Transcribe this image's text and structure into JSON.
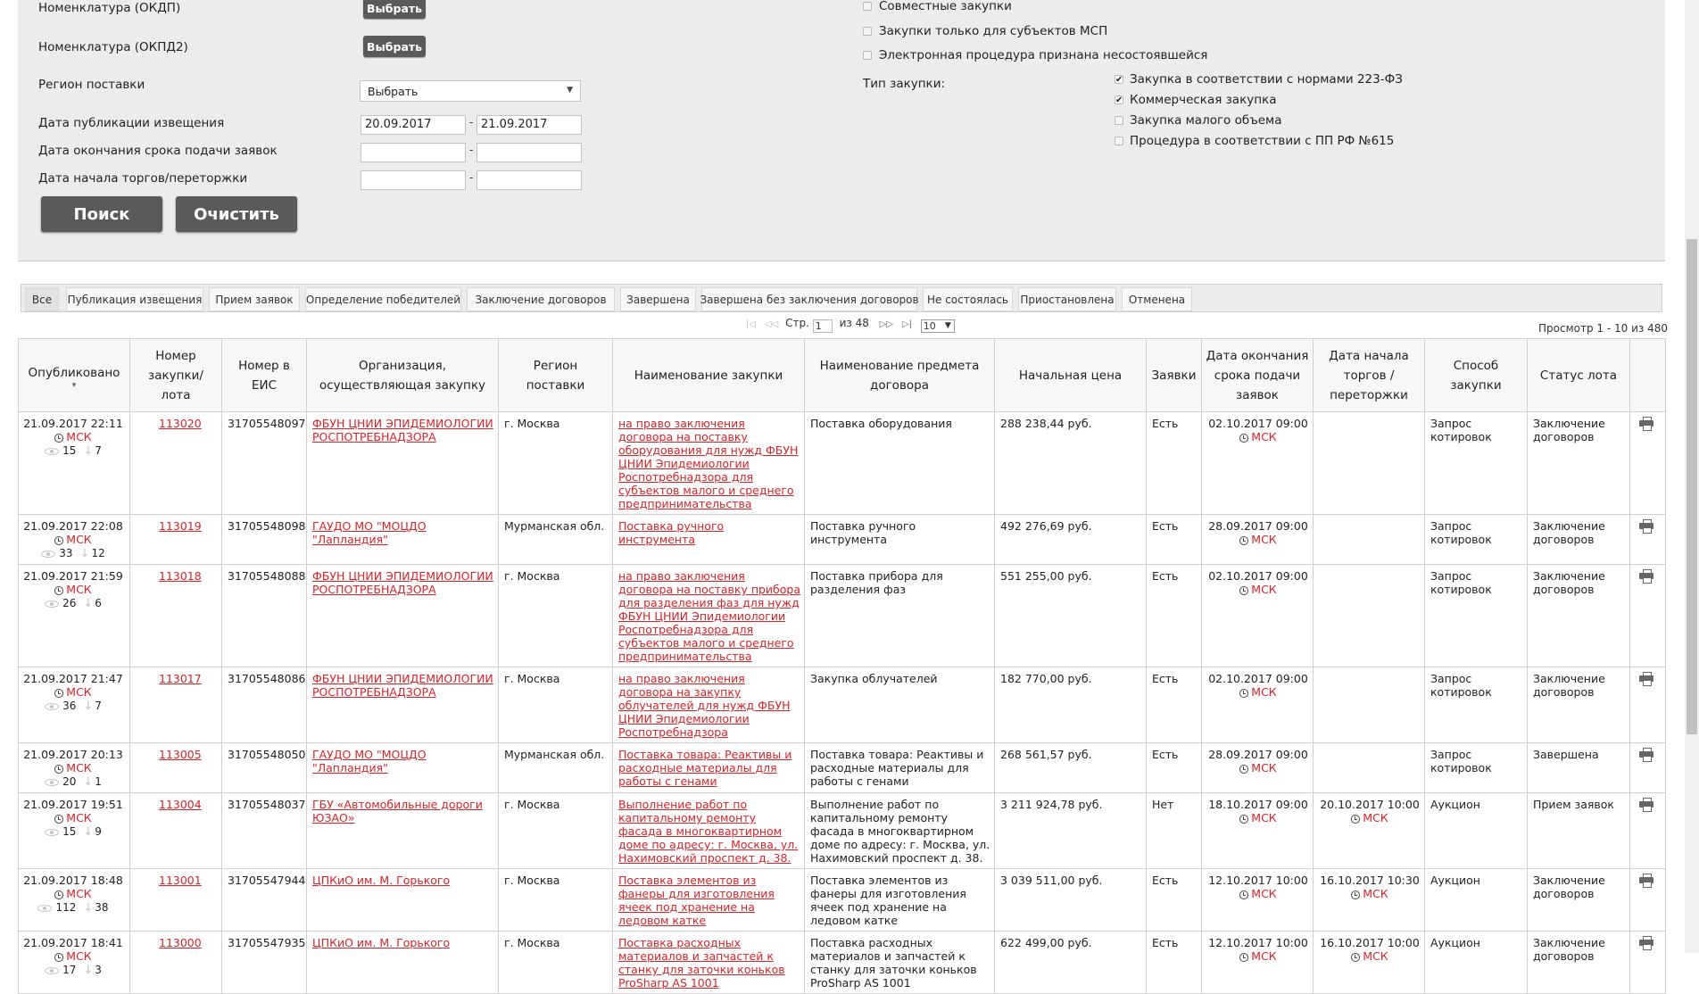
{
  "filters": {
    "okdp_label": "Номенклатура (ОКДП)",
    "okpd2_label": "Номенклатура (ОКПД2)",
    "choose_button": "Выбрать",
    "region_label": "Регион поставки",
    "region_value": "Выбрать",
    "pub_date_label": "Дата публикации извещения",
    "pub_date_from": "20.09.2017",
    "pub_date_to": "21.09.2017",
    "deadline_label": "Дата окончания срока подачи заявок",
    "auction_label": "Дата начала торгов/переторжки",
    "dash": "-",
    "search_button": "Поиск",
    "clear_button": "Очистить",
    "joint_label": "Совместные закупки",
    "msp_label": "Закупки только для субъектов МСП",
    "failed_label": "Электронная процедура признана несостоявшейся",
    "type_label": "Тип закупки:",
    "type_options": [
      {
        "label": "Закупка в соответствии с нормами 223-ФЗ",
        "checked": true,
        "mark": "✔"
      },
      {
        "label": "Коммерческая закупка",
        "checked": true,
        "mark": "✔"
      },
      {
        "label": "Закупка малого объема",
        "checked": false,
        "mark": ""
      },
      {
        "label": "Процедура в соответствии с ПП РФ №615",
        "checked": false,
        "mark": ""
      }
    ]
  },
  "tabs": [
    "Все",
    "Публикация извещения",
    "Прием заявок",
    "Определение победителей",
    "Заключение договоров",
    "Завершена",
    "Завершена без заключения договоров",
    "Не состоялась",
    "Приостановлена",
    "Отменена"
  ],
  "pager": {
    "first": "|◁",
    "prev": "◁◁",
    "page_label": "Стр.",
    "page": "1",
    "of_label": "из 48",
    "next": "▷▷",
    "last": "▷|",
    "per_page": "10",
    "view_text": "Просмотр 1 - 10 из 480"
  },
  "columns": {
    "published": "Опубликовано",
    "number": "Номер закупки/лота",
    "eis": "Номер в ЕИС",
    "org": "Организация, осуществляющая закупку",
    "region": "Регион поставки",
    "name": "Наименование закупки",
    "subject": "Наименование предмета договора",
    "price": "Начальная цена",
    "bids": "Заявки",
    "deadline": "Дата окончания срока подачи заявок",
    "auction": "Дата начала торгов / переторжки",
    "method": "Способ закупки",
    "status": "Статус лота",
    "sort_arrow": "▾"
  },
  "msk": "МСК",
  "rows": [
    {
      "published": "21.09.2017 22:11",
      "views": "15",
      "downloads": "7",
      "number": "113020",
      "eis": "31705548097",
      "org": "ФБУН ЦНИИ ЭПИДЕМИОЛОГИИ РОСПОТРЕБНАДЗОРА",
      "region": "г. Москва",
      "name": "на право заключения договора на поставку оборудования для нужд ФБУН ЦНИИ Эпидемиологии Роспотребнадзора для субъектов малого и среднего предпринимательства",
      "subject": "Поставка оборудования",
      "price": "288 238,44 руб.",
      "bids": "Есть",
      "deadline": "02.10.2017 09:00",
      "auction": "",
      "method": "Запрос котировок",
      "status": "Заключение договоров"
    },
    {
      "published": "21.09.2017 22:08",
      "views": "33",
      "downloads": "12",
      "number": "113019",
      "eis": "31705548098",
      "org": "ГАУДО МО \"МОЦДО \"Лапландия\"",
      "region": "Мурманская обл.",
      "name": "Поставка ручного инструмента",
      "subject": "Поставка ручного инструмента",
      "price": "492 276,69 руб.",
      "bids": "Есть",
      "deadline": "28.09.2017 09:00",
      "auction": "",
      "method": "Запрос котировок",
      "status": "Заключение договоров"
    },
    {
      "published": "21.09.2017 21:59",
      "views": "26",
      "downloads": "6",
      "number": "113018",
      "eis": "31705548088",
      "org": "ФБУН ЦНИИ ЭПИДЕМИОЛОГИИ РОСПОТРЕБНАДЗОРА",
      "region": "г. Москва",
      "name": "на право заключения договора на поставку прибора для разделения фаз для нужд ФБУН ЦНИИ Эпидемиологии Роспотребнадзора для субъектов малого и среднего предпринимательства",
      "subject": "Поставка прибора для разделения фаз",
      "price": "551 255,00 руб.",
      "bids": "Есть",
      "deadline": "02.10.2017 09:00",
      "auction": "",
      "method": "Запрос котировок",
      "status": "Заключение договоров"
    },
    {
      "published": "21.09.2017 21:47",
      "views": "36",
      "downloads": "7",
      "number": "113017",
      "eis": "31705548086",
      "org": "ФБУН ЦНИИ ЭПИДЕМИОЛОГИИ РОСПОТРЕБНАДЗОРА",
      "region": "г. Москва",
      "name": "на право заключения договора на закупку облучателей для нужд ФБУН ЦНИИ Эпидемиологии Роспотребнадзора",
      "subject": "Закупка облучателей",
      "price": "182 770,00 руб.",
      "bids": "Есть",
      "deadline": "02.10.2017 09:00",
      "auction": "",
      "method": "Запрос котировок",
      "status": "Заключение договоров"
    },
    {
      "published": "21.09.2017 20:13",
      "views": "20",
      "downloads": "1",
      "number": "113005",
      "eis": "31705548050",
      "org": "ГАУДО МО \"МОЦДО \"Лапландия\"",
      "region": "Мурманская обл.",
      "name": "Поставка товара: Реактивы и расходные материалы для работы с генами",
      "subject": "Поставка товара: Реактивы и расходные материалы для работы с генами",
      "price": "268 561,57 руб.",
      "bids": "Есть",
      "deadline": "28.09.2017 09:00",
      "auction": "",
      "method": "Запрос котировок",
      "status": "Завершена"
    },
    {
      "published": "21.09.2017 19:51",
      "views": "15",
      "downloads": "9",
      "number": "113004",
      "eis": "31705548037",
      "org": "ГБУ «Автомобильные дороги ЮЗАО»",
      "region": "г. Москва",
      "name": "Выполнение работ по капитальному ремонту фасада в многоквартирном доме по адресу: г. Москва, ул. Нахимовский проспект д. 38.",
      "subject": "Выполнение работ по капитальному ремонту фасада в многоквартирном доме по адресу: г. Москва, ул. Нахимовский проспект д. 38.",
      "price": "3 211 924,78 руб.",
      "bids": "Нет",
      "deadline": "18.10.2017 09:00",
      "auction": "20.10.2017 10:00",
      "method": "Аукцион",
      "status": "Прием заявок"
    },
    {
      "published": "21.09.2017 18:48",
      "views": "112",
      "downloads": "38",
      "number": "113001",
      "eis": "31705547944",
      "org": "ЦПКиО им. М. Горького",
      "region": "г. Москва",
      "name": "Поставка элементов из фанеры для изготовления ячеек под хранение на ледовом катке",
      "subject": "Поставка элементов из фанеры для изготовления ячеек под хранение на ледовом катке",
      "price": "3 039 511,00 руб.",
      "bids": "Есть",
      "deadline": "12.10.2017 10:00",
      "auction": "16.10.2017 10:30",
      "method": "Аукцион",
      "status": "Заключение договоров"
    },
    {
      "published": "21.09.2017 18:41",
      "views": "17",
      "downloads": "3",
      "number": "113000",
      "eis": "31705547935",
      "org": "ЦПКиО им. М. Горького",
      "region": "г. Москва",
      "name": "Поставка расходных материалов и запчастей к станку для заточки коньков ProSharp AS 1001",
      "subject": "Поставка расходных материалов и запчастей к станку для заточки коньков ProSharp AS 1001",
      "price": "622 499,00 руб.",
      "bids": "Есть",
      "deadline": "12.10.2017 10:00",
      "auction": "16.10.2017 10:00",
      "method": "Аукцион",
      "status": "Заключение договоров"
    }
  ]
}
